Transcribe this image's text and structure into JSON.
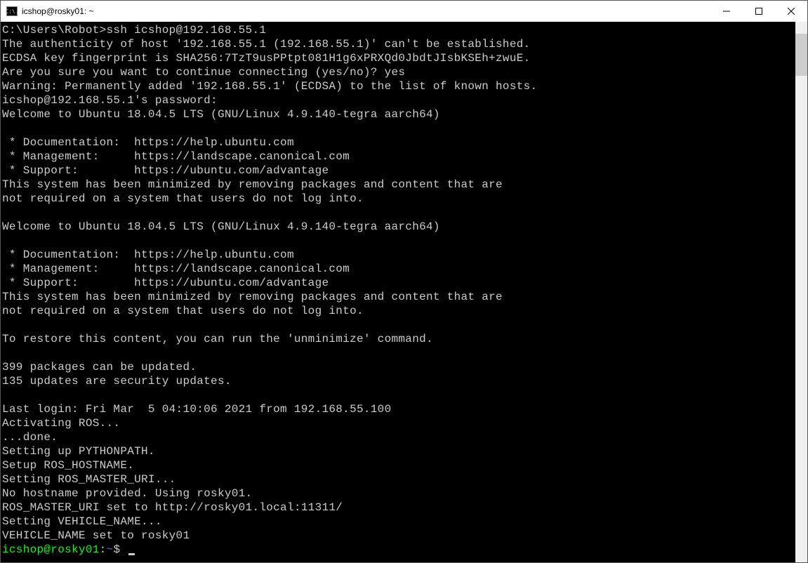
{
  "window": {
    "title": "icshop@rosky01: ~",
    "icon_text": "C:\\."
  },
  "terminal": {
    "lines": [
      "C:\\Users\\Robot>ssh icshop@192.168.55.1",
      "The authenticity of host '192.168.55.1 (192.168.55.1)' can't be established.",
      "ECDSA key fingerprint is SHA256:7TzT9usPPtpt081H1g6xPRXQd0JbdtJIsbKSEh+zwuE.",
      "Are you sure you want to continue connecting (yes/no)? yes",
      "Warning: Permanently added '192.168.55.1' (ECDSA) to the list of known hosts.",
      "icshop@192.168.55.1's password:",
      "Welcome to Ubuntu 18.04.5 LTS (GNU/Linux 4.9.140-tegra aarch64)",
      "",
      " * Documentation:  https://help.ubuntu.com",
      " * Management:     https://landscape.canonical.com",
      " * Support:        https://ubuntu.com/advantage",
      "This system has been minimized by removing packages and content that are",
      "not required on a system that users do not log into.",
      "",
      "Welcome to Ubuntu 18.04.5 LTS (GNU/Linux 4.9.140-tegra aarch64)",
      "",
      " * Documentation:  https://help.ubuntu.com",
      " * Management:     https://landscape.canonical.com",
      " * Support:        https://ubuntu.com/advantage",
      "This system has been minimized by removing packages and content that are",
      "not required on a system that users do not log into.",
      "",
      "To restore this content, you can run the 'unminimize' command.",
      "",
      "399 packages can be updated.",
      "135 updates are security updates.",
      "",
      "Last login: Fri Mar  5 04:10:06 2021 from 192.168.55.100",
      "Activating ROS...",
      "...done.",
      "Setting up PYTHONPATH.",
      "Setup ROS_HOSTNAME.",
      "Setting ROS_MASTER_URI...",
      "No hostname provided. Using rosky01.",
      "ROS_MASTER_URI set to http://rosky01.local:11311/",
      "Setting VEHICLE_NAME...",
      "VEHICLE_NAME set to rosky01"
    ],
    "prompt": {
      "user_host": "icshop@rosky01",
      "colon": ":",
      "path": "~",
      "dollar": "$"
    }
  }
}
